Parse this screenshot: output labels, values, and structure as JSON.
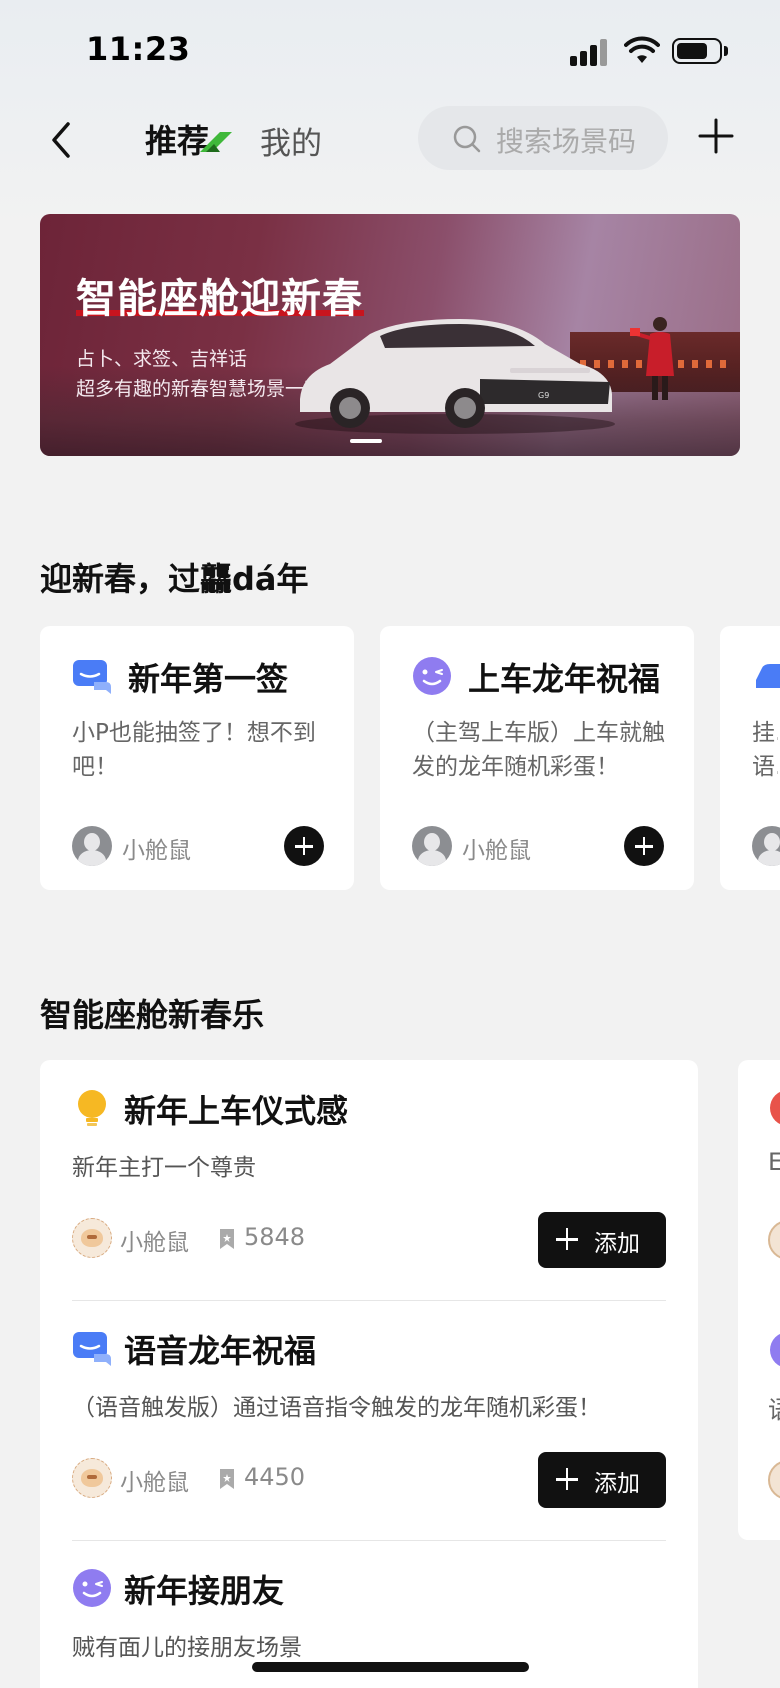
{
  "status_bar": {
    "time": "11:23",
    "battery_level": 0.75
  },
  "nav": {
    "tab_recommended": "推荐",
    "tab_mine": "我的",
    "search_placeholder": "搜索场景码"
  },
  "banner": {
    "title": "智能座舱迎新春",
    "subtitle_line1": "占卜、求签、吉祥话",
    "subtitle_line2": "超多有趣的新春智慧场景一次码住",
    "car_plate": "G9"
  },
  "section1": {
    "title": "迎新春，过龘dá年",
    "cards": [
      {
        "icon": "chat-bubble-icon",
        "title": "新年第一签",
        "desc": "小P也能抽签了！想不到吧！",
        "author": "小舱鼠"
      },
      {
        "icon": "wink-face-icon",
        "title": "上车龙年祝福",
        "desc": "（主驾上车版）上车就触发的龙年随机彩蛋！",
        "author": "小舱鼠"
      },
      {
        "icon": "car-icon",
        "title": "",
        "desc": "挂…语…",
        "author": ""
      }
    ]
  },
  "section2": {
    "title": "智能座舱新春乐",
    "items": [
      {
        "icon": "lightbulb-icon",
        "title": "新年上车仪式感",
        "desc": "新年主打一个尊贵",
        "author": "小舱鼠",
        "count": "5848",
        "button": "添加"
      },
      {
        "icon": "chat-bubble-icon",
        "title": "语音龙年祝福",
        "desc": "（语音触发版）通过语音指令触发的龙年随机彩蛋！",
        "author": "小舱鼠",
        "count": "4450",
        "button": "添加"
      },
      {
        "icon": "wink-face-icon",
        "title": "新年接朋友",
        "desc": "贼有面儿的接朋友场景"
      }
    ],
    "peek_letters": [
      "E",
      "语"
    ]
  },
  "colors": {
    "accent_black": "#111111",
    "banner_red": "#c8141e",
    "icon_blue": "#4a7cf6",
    "icon_purple": "#8f7cf0",
    "icon_yellow": "#f6b823"
  }
}
